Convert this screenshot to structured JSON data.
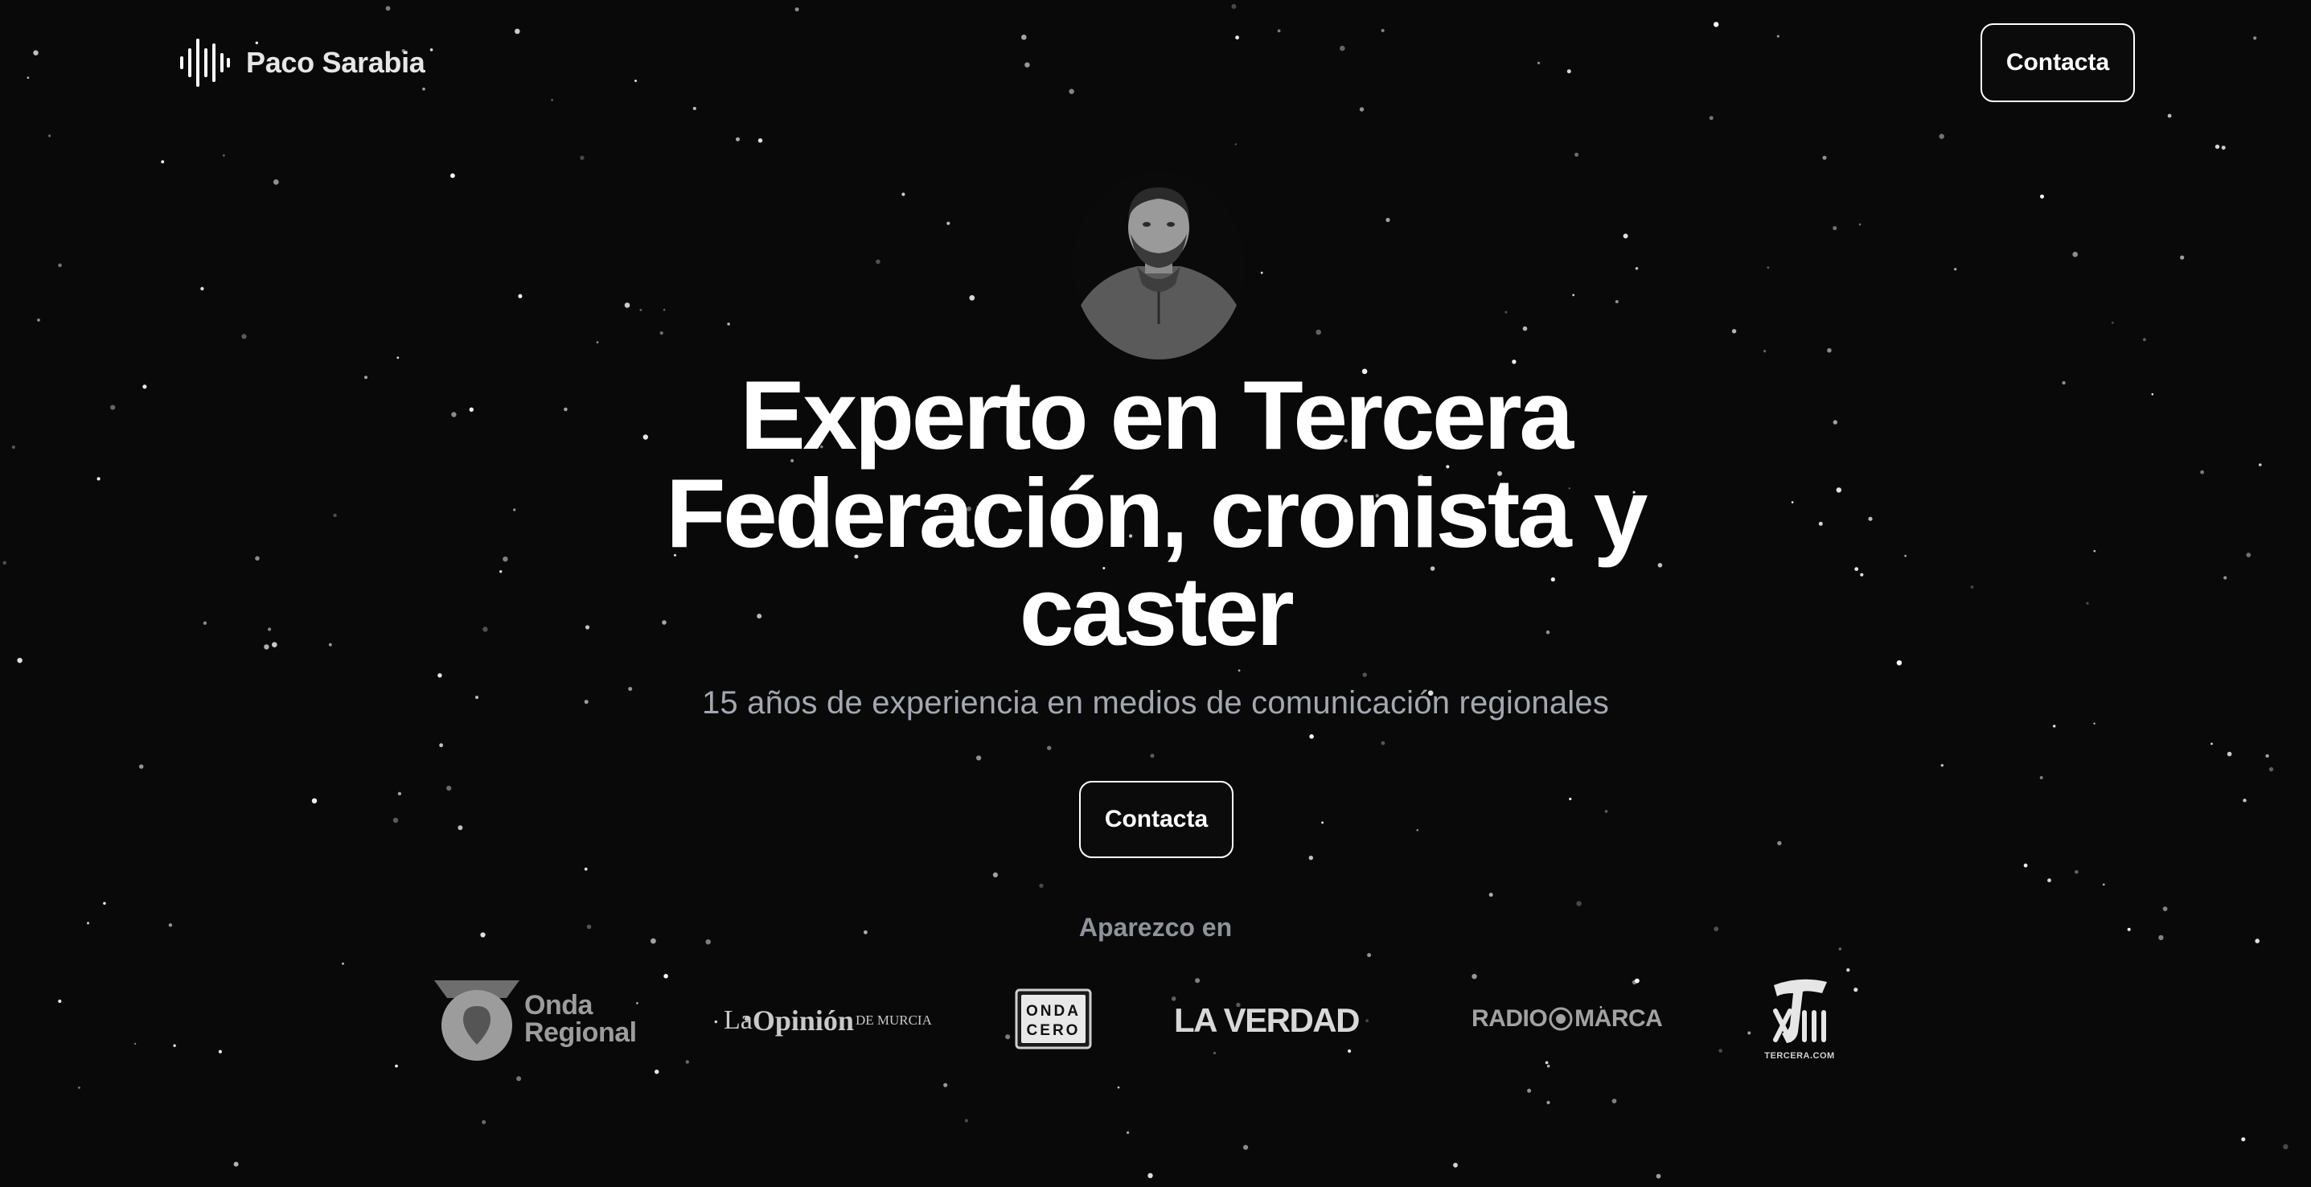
{
  "brand": {
    "name": "Paco Sarabia",
    "icon": "sound-wave-icon"
  },
  "nav": {
    "contact_label": "Contacta"
  },
  "hero": {
    "avatar_alt": "portrait",
    "headline_line1": "Experto en Tercera",
    "headline_line2": "Federación, cronista y",
    "headline_line3": "caster",
    "subtitle": "15 años de experiencia en medios de comunicación regionales",
    "contact_label": "Contacta"
  },
  "media": {
    "label": "Aparezco en",
    "logos": {
      "onda_regional_1": "Onda",
      "onda_regional_2": "Regional",
      "la_opinion_la": "La",
      "la_opinion_op": "Opinión",
      "la_opinion_dm": "DE MURCIA",
      "onda_cero_1": "ONDA",
      "onda_cero_2": "CERO",
      "la_verdad": "LA VERDAD",
      "radio_marca_1": "RADIO",
      "radio_marca_2": "MARCA",
      "tercera": "TERCERA.COM"
    }
  },
  "colors": {
    "background": "#090909",
    "text": "#ffffff",
    "subtitle": "#a3a7b0",
    "muted": "#8e929b"
  }
}
